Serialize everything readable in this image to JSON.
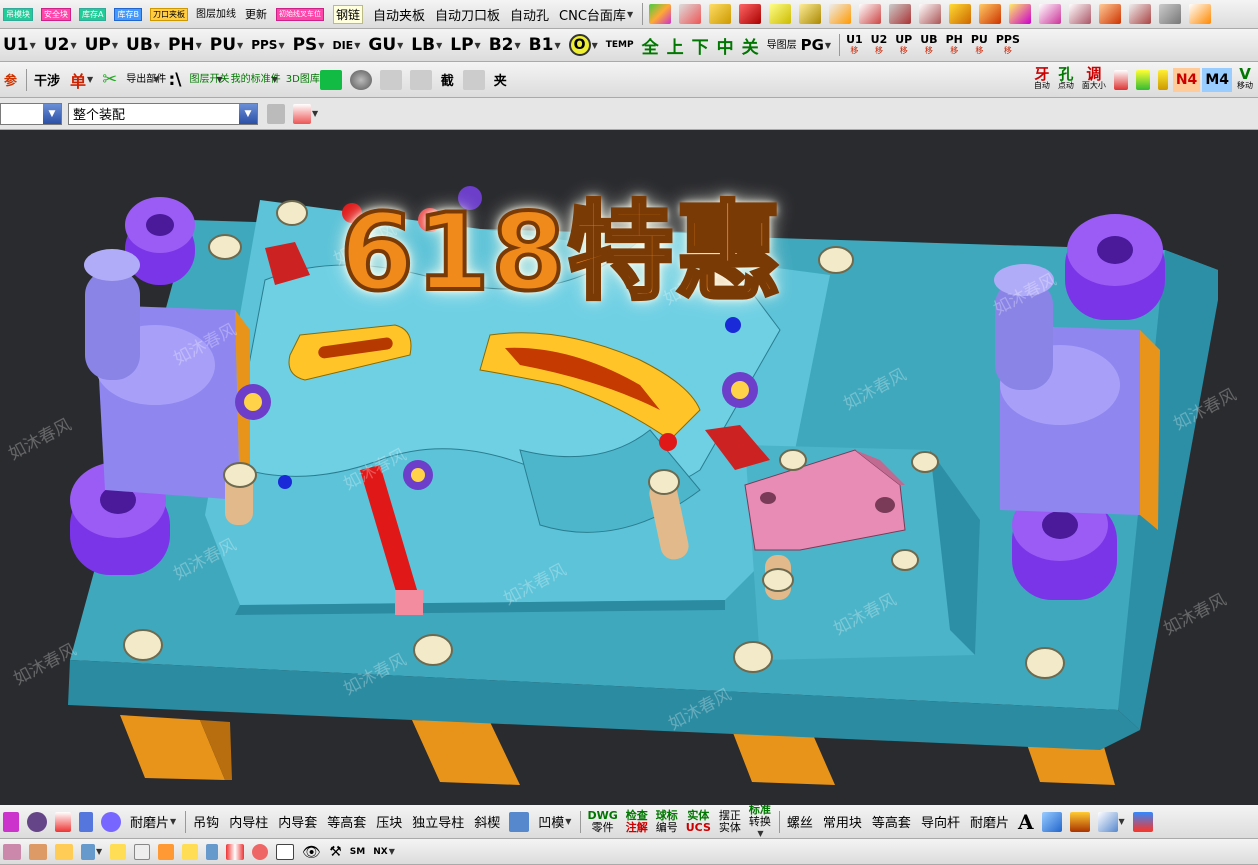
{
  "toolbar1": {
    "small_buttons": [
      "吊模块",
      "安全块",
      "库存A",
      "库存B",
      "刀口夹板",
      "图层加线"
    ],
    "update_label": "更新",
    "init_label": "初始线叉车位",
    "chain_label": "钢链",
    "text_buttons": [
      "自动夹板",
      "自动刀口板",
      "自动孔",
      "CNC台面库"
    ]
  },
  "toolbar2": {
    "buttons": [
      "U1",
      "U2",
      "UP",
      "UB",
      "PH",
      "PU",
      "PPS",
      "PS",
      "DIE",
      "GU",
      "LB",
      "LP",
      "B2",
      "B1"
    ],
    "o_label": "O",
    "temp_label": "TEMP",
    "cn_buttons": [
      "全",
      "上",
      "下",
      "中",
      "关"
    ],
    "guide_label": "导图层",
    "pg_label": "PG",
    "move_buttons": [
      {
        "top": "U1",
        "sub": "移"
      },
      {
        "top": "U2",
        "sub": "移"
      },
      {
        "top": "UP",
        "sub": "移"
      },
      {
        "top": "UB",
        "sub": "移"
      },
      {
        "top": "PH",
        "sub": "移"
      },
      {
        "top": "PU",
        "sub": "移"
      },
      {
        "top": "PPS",
        "sub": "移"
      }
    ]
  },
  "toolbar3": {
    "left_items": [
      "参",
      "干涉",
      "单",
      "导出部件",
      ":\\"
    ],
    "layer_label": "图层开关",
    "std_label": "我的标准件",
    "lib_label": "3D图库",
    "right_items": [
      {
        "top": "牙",
        "sub": "自动"
      },
      {
        "top": "孔",
        "sub": "点动"
      },
      {
        "top": "调",
        "sub": "面大小"
      },
      {
        "top": "N4",
        "sub": ""
      },
      {
        "top": "M4",
        "sub": ""
      },
      {
        "top": "V",
        "sub": "移动"
      }
    ],
    "partial_labels": [
      "截",
      "夹"
    ]
  },
  "toolbar4": {
    "combo1_value": "",
    "combo2_value": "整个装配"
  },
  "promo": {
    "text": "618特惠"
  },
  "watermark": "如沐春风",
  "bottom1": {
    "first_label": "耐磨片",
    "items": [
      "吊钩",
      "内导柱",
      "内导套",
      "等高套",
      "压块",
      "独立导柱",
      "斜楔"
    ],
    "die_label": "凹模",
    "dwg": {
      "top": "DWG",
      "bottom": "零件"
    },
    "check": {
      "top": "检查",
      "bottom": "注解"
    },
    "ball": {
      "top": "球标",
      "bottom": "编号"
    },
    "solid": {
      "top": "实体",
      "bottom": "UCS"
    },
    "straight": {
      "top": "摆正",
      "bottom": "实体"
    },
    "std": {
      "top": "标准",
      "bottom": "转换"
    },
    "right_items": [
      "螺丝",
      "常用块",
      "等高套",
      "导向杆",
      "耐磨片"
    ],
    "a_label": "A"
  },
  "bottom2": {
    "sm_label": "SM",
    "nx_label": "NX"
  },
  "colors": {
    "plate": "#4fb6c9",
    "pillar": "#7a3ee0",
    "accent_orange": "#f5a623",
    "pink_block": "#e88ab0",
    "background_3d": "#2a2b2e"
  }
}
